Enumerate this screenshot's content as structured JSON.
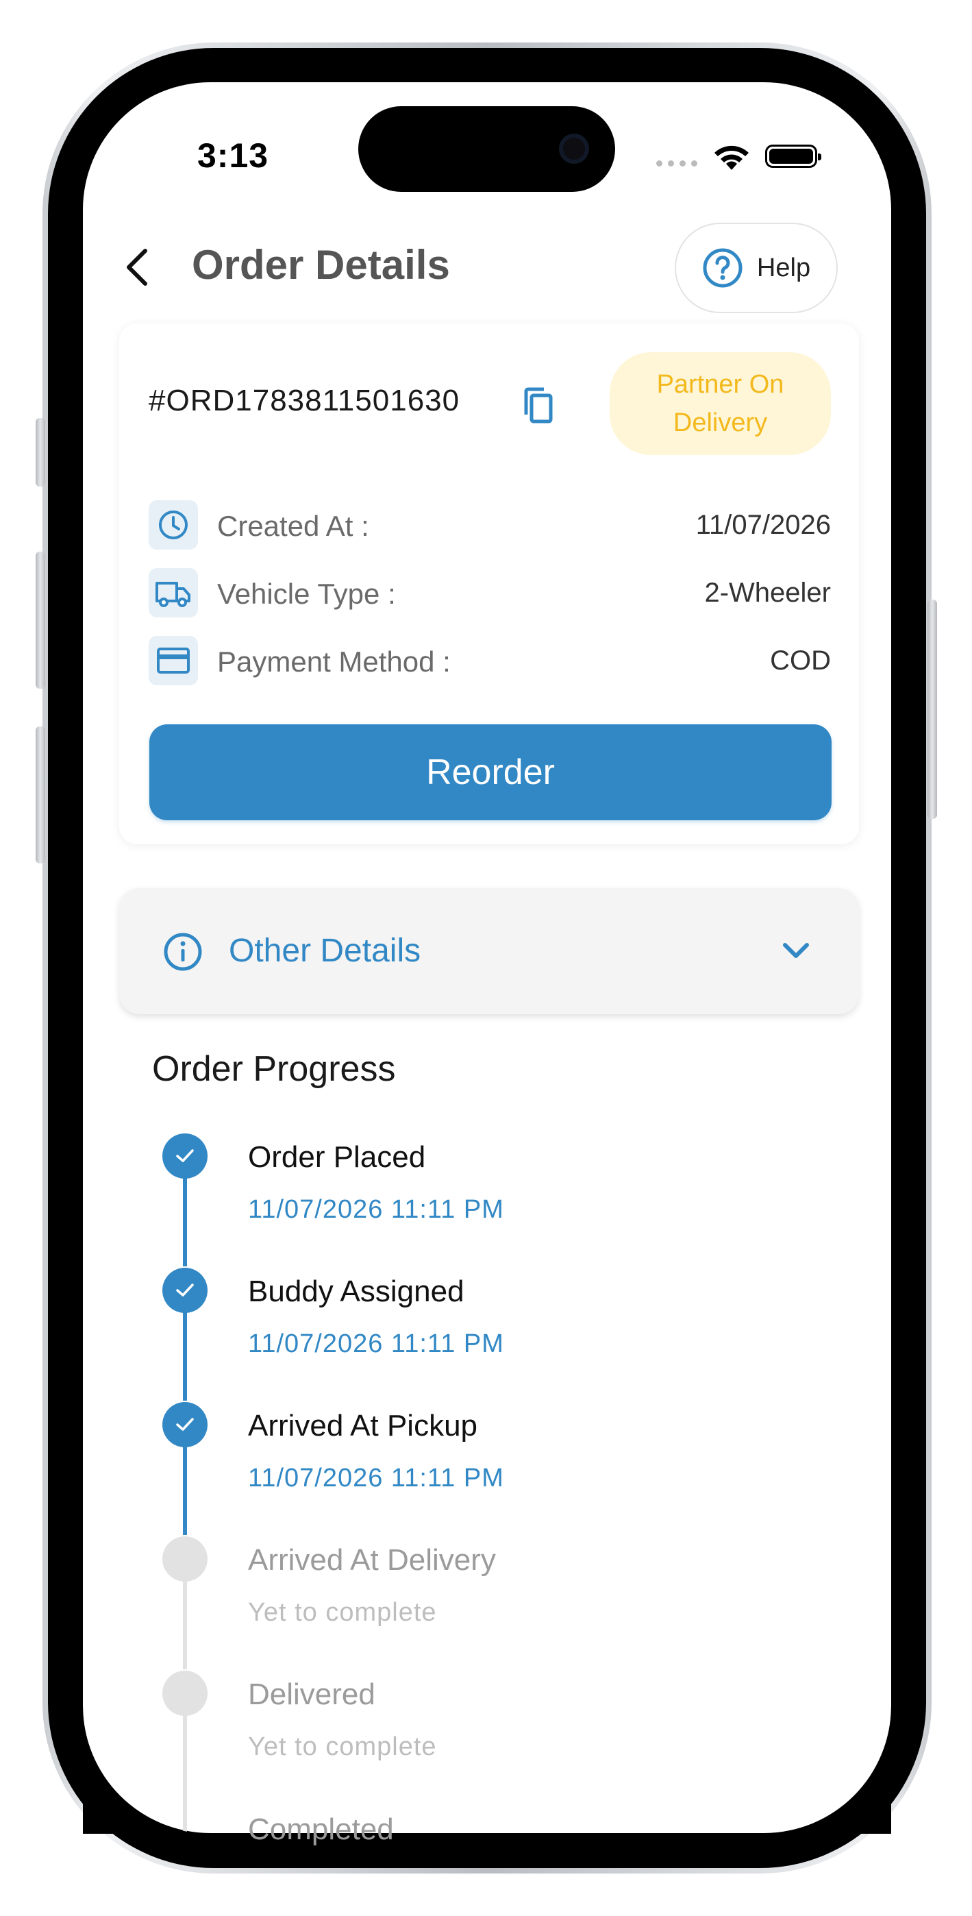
{
  "status_bar": {
    "time": "3:13"
  },
  "header": {
    "title": "Order Details",
    "help_label": "Help"
  },
  "order": {
    "id": "#ORD1783811501630",
    "status": "Partner On Delivery",
    "details": [
      {
        "icon": "clock-icon",
        "label": "Created At :",
        "value": "11/07/2026"
      },
      {
        "icon": "truck-icon",
        "label": "Vehicle Type :",
        "value": "2-Wheeler"
      },
      {
        "icon": "credit-card-icon",
        "label": "Payment Method :",
        "value": "COD"
      }
    ],
    "reorder_label": "Reorder"
  },
  "other_details": {
    "label": "Other Details"
  },
  "progress": {
    "title": "Order Progress",
    "steps": [
      {
        "title": "Order Placed",
        "subtitle": "11/07/2026 11:11 PM",
        "completed": true
      },
      {
        "title": "Buddy Assigned",
        "subtitle": "11/07/2026 11:11 PM",
        "completed": true
      },
      {
        "title": "Arrived At Pickup",
        "subtitle": "11/07/2026 11:11 PM",
        "completed": true
      },
      {
        "title": "Arrived At Delivery",
        "subtitle": "Yet to complete",
        "completed": false
      },
      {
        "title": "Delivered",
        "subtitle": "Yet to complete",
        "completed": false
      },
      {
        "title": "Completed",
        "subtitle": "",
        "completed": false
      }
    ]
  },
  "colors": {
    "accent": "#3188c5",
    "badge_bg": "#fff6d8",
    "badge_text": "#f3b81b",
    "pending": "#e2e2e2"
  }
}
